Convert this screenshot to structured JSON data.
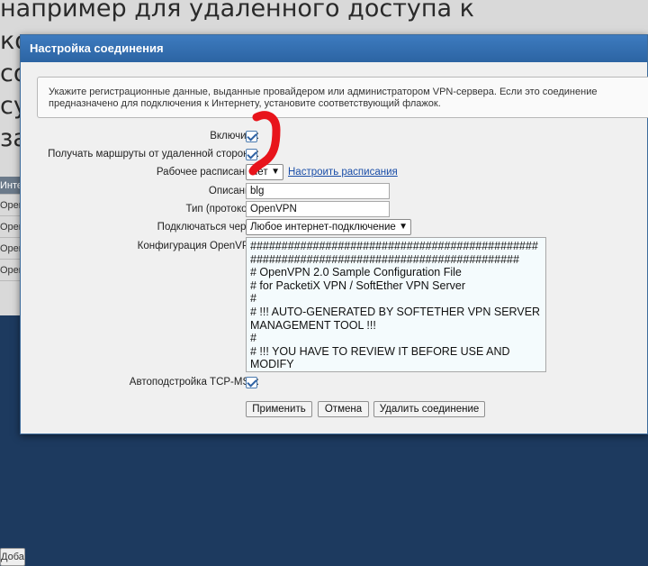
{
  "background": {
    "heading_lines": [
      "например для удаленного доступа к",
      "ко",
      "со",
      "су",
      "за"
    ],
    "table_rows": [
      "Инте",
      "OpenV",
      "OpenV",
      "OpenV",
      "OpenV"
    ],
    "add_button": "Доба"
  },
  "dialog": {
    "title": "Настройка соединения",
    "info_text": "Укажите регистрационные данные, выданные провайдером или администратором VPN-сервера. Если это соединение предназначено для подключения к Интернету, установите соответствующий флажок.",
    "fields": {
      "enable_label": "Включить:",
      "routes_label": "Получать маршруты от удаленной стороны:",
      "schedule_label": "Рабочее расписание:",
      "schedule_value": "Нет",
      "schedule_link": "Настроить расписания",
      "description_label": "Описание:",
      "description_value": "blg",
      "type_label": "Тип (протокол):",
      "type_value": "OpenVPN",
      "connect_via_label": "Подключаться через:",
      "connect_via_value": "Любое интернет-подключение",
      "config_label": "Конфигурация OpenVPN:",
      "config_value": "##############################################\n###########################################\n# OpenVPN 2.0 Sample Configuration File\n# for PacketiX VPN / SoftEther VPN Server\n#\n# !!! AUTO-GENERATED BY SOFTETHER VPN SERVER\nMANAGEMENT TOOL !!!\n#\n# !!! YOU HAVE TO REVIEW IT BEFORE USE AND MODIFY\nIT AS NECESSARY !!!",
      "tcp_mss_label": "Автоподстройка TCP-MSS:"
    },
    "buttons": {
      "apply": "Применить",
      "cancel": "Отмена",
      "delete": "Удалить соединение"
    }
  },
  "colors": {
    "titlebar": "#2c64a3",
    "annotation": "#e8141b"
  }
}
